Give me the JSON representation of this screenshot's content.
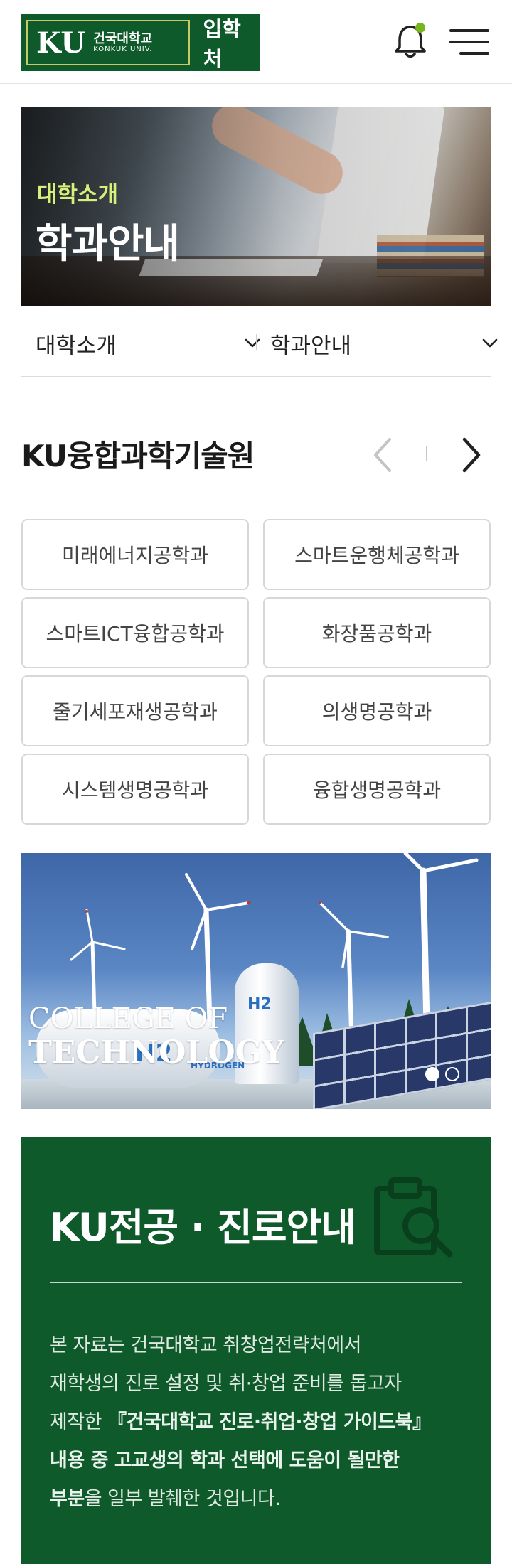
{
  "header": {
    "logo_ku": "KU",
    "logo_kr": "건국대학교",
    "logo_en": "KONKUK UNIV.",
    "logo_office": "입학처",
    "bell_icon": "bell-icon",
    "menu_icon": "hamburger-menu-icon",
    "accent": "#0f5a2a",
    "notification_dot": "#7ab51d"
  },
  "hero": {
    "subtitle": "대학소개",
    "title": "학과안내"
  },
  "breadcrumb": {
    "select1": "대학소개",
    "select2": "학과안내"
  },
  "section": {
    "title": "KU융합과학기술원",
    "departments": [
      "미래에너지공학과",
      "스마트운행체공학과",
      "스마트ICT융합공학과",
      "화장품공학과",
      "줄기세포재생공학과",
      "의생명공학과",
      "시스템생명공학과",
      "융합생명공학과"
    ]
  },
  "banner": {
    "line1": "COLLEGE OF",
    "line2": "TECHNOLOGY",
    "h2_big": "H2",
    "h2_small": "H2",
    "hydrogen": "HYDROGEN",
    "slides": 2,
    "active_slide": 1
  },
  "card": {
    "title": "KU전공 · 진로안내",
    "text_1": "본 자료는 건국대학교 취창업전략처에서",
    "text_2": "재학생의 진로 설정 및 취·창업 준비를 돕고자",
    "text_3": "제작한 ",
    "text_3_bold": "『건국대학교 진로·취업·창업 가이드북』",
    "text_4_bold": "내용 중 고교생의 학과 선택에 도움이 될만한",
    "text_5_bold": "부분",
    "text_5": "을 일부 발췌한 것입니다."
  }
}
